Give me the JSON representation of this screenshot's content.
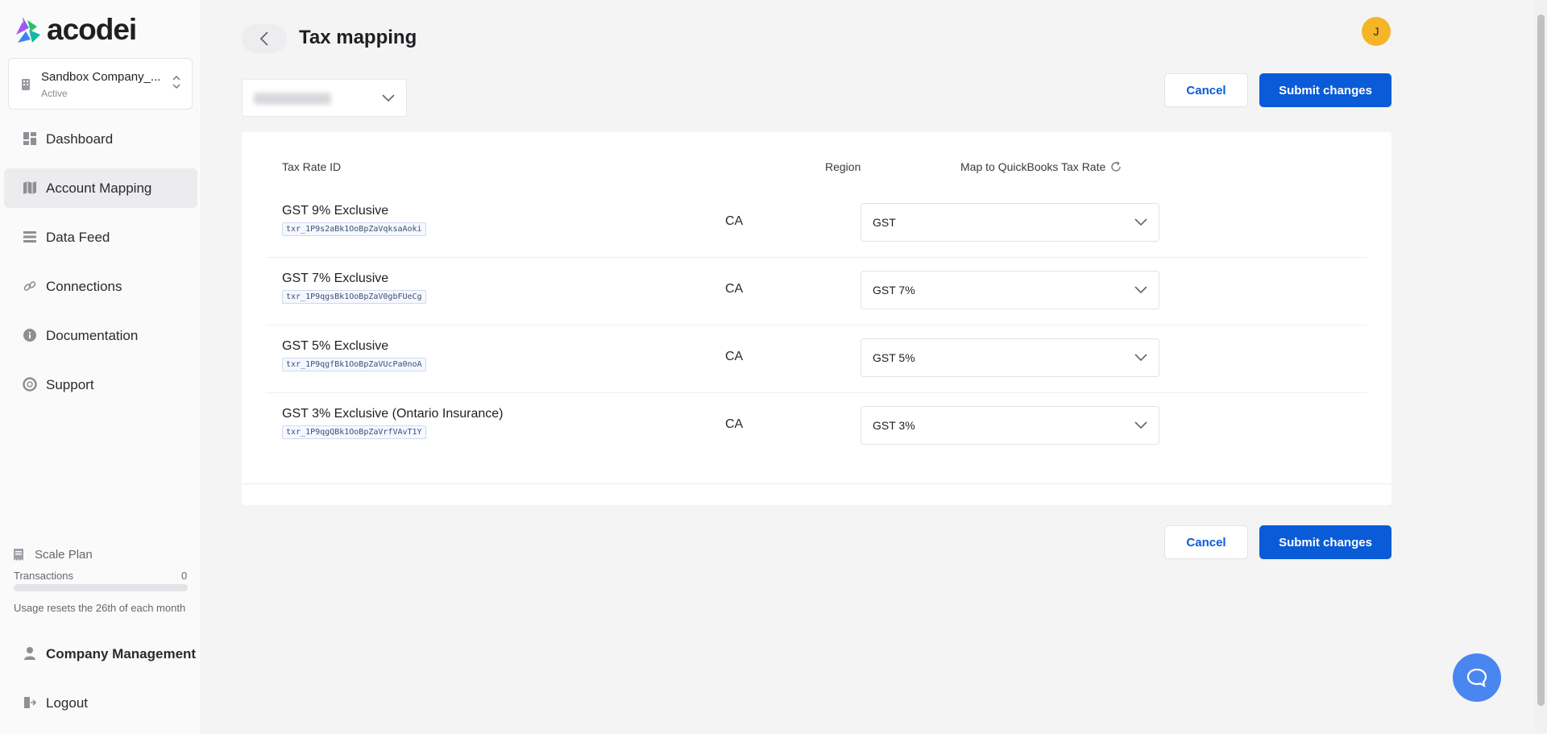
{
  "brand": {
    "name": "acodei"
  },
  "company": {
    "name": "Sandbox Company_...",
    "status": "Active"
  },
  "nav": [
    {
      "label": "Dashboard",
      "icon": "dashboard-icon"
    },
    {
      "label": "Account Mapping",
      "icon": "map-icon",
      "active": true
    },
    {
      "label": "Data Feed",
      "icon": "list-icon"
    },
    {
      "label": "Connections",
      "icon": "link-icon"
    },
    {
      "label": "Documentation",
      "icon": "info-icon"
    },
    {
      "label": "Support",
      "icon": "lifebuoy-icon"
    }
  ],
  "plan": {
    "name": "Scale Plan",
    "transactions_label": "Transactions",
    "transactions_count": "0",
    "usage_fraction": 0,
    "usage_note": "Usage resets the 26th of each month"
  },
  "footer_nav": [
    {
      "label": "Company Management",
      "icon": "user-icon"
    },
    {
      "label": "Logout",
      "icon": "logout-icon"
    }
  ],
  "page": {
    "title": "Tax mapping"
  },
  "user": {
    "initial": "J"
  },
  "actions": {
    "cancel": "Cancel",
    "submit": "Submit changes"
  },
  "table": {
    "headers": {
      "tax_rate_id": "Tax Rate ID",
      "region": "Region",
      "map_to": "Map to QuickBooks Tax Rate"
    },
    "rows": [
      {
        "name": "GST 9% Exclusive",
        "id": "txr_1P9s2aBk1OoBpZaVqksaAoki",
        "region": "CA",
        "mapped": "GST"
      },
      {
        "name": "GST 7% Exclusive",
        "id": "txr_1P9qgsBk1OoBpZaV0gbFUeCg",
        "region": "CA",
        "mapped": "GST 7%"
      },
      {
        "name": "GST 5% Exclusive",
        "id": "txr_1P9qgfBk1OoBpZaVUcPa0noA",
        "region": "CA",
        "mapped": "GST 5%"
      },
      {
        "name": "GST 3% Exclusive (Ontario Insurance)",
        "id": "txr_1P9qgQBk1OoBpZaVrfVAvT1Y",
        "region": "CA",
        "mapped": "GST 3%"
      }
    ]
  },
  "colors": {
    "primary": "#0a5bd7",
    "avatar": "#f6b526",
    "help": "#4a86f0"
  }
}
